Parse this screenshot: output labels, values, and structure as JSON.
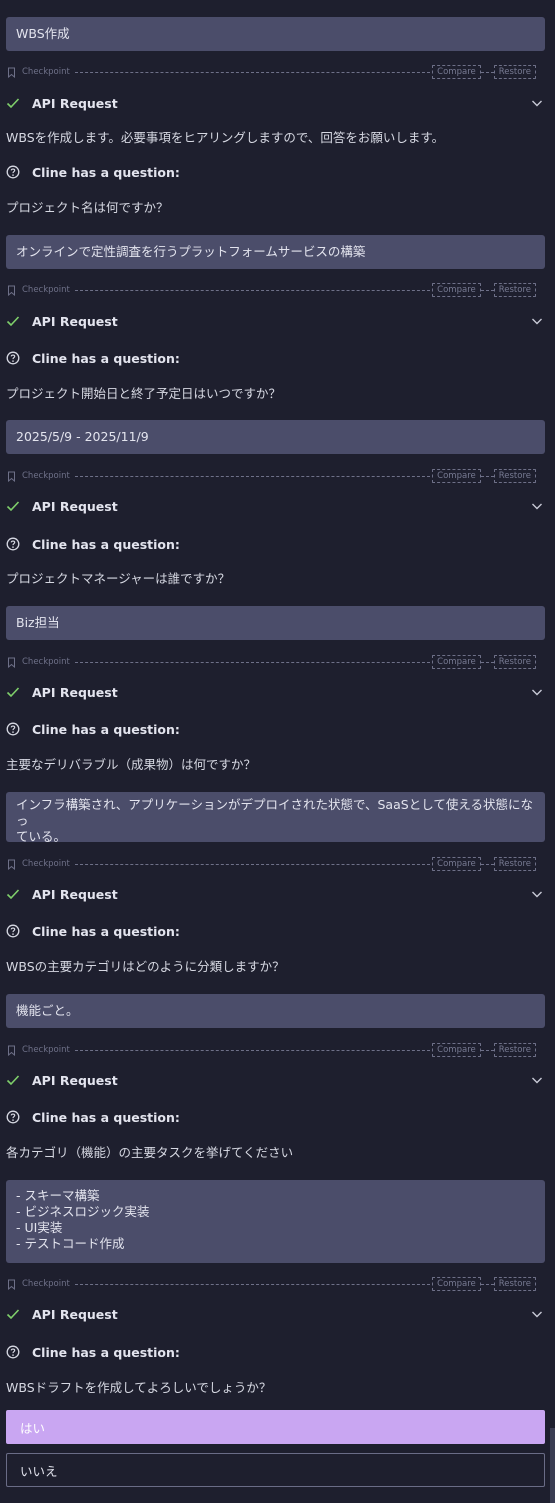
{
  "colors": {
    "background": "#1e1f2e",
    "user_bubble": "#4b4d6a",
    "check_green": "#7fcf6b",
    "primary_button": "#c9a6f2",
    "secondary_border": "#6a6c86"
  },
  "icons": {
    "checkpoint": "bookmark-icon",
    "success": "check-icon",
    "question": "question-circle-icon",
    "expand": "chevron-down-icon"
  },
  "labels": {
    "checkpoint": "Checkpoint",
    "compare": "Compare",
    "restore": "Restore",
    "api_request": "API Request",
    "question": "Cline has a question:"
  },
  "messages": {
    "u0": "WBS作成",
    "t0": "WBSを作成します。必要事項をヒアリングしますので、回答をお願いします。",
    "q1": "プロジェクト名は何ですか？",
    "u1": "オンラインで定性調査を行うプラットフォームサービスの構築",
    "q2": "プロジェクト開始日と終了予定日はいつですか？",
    "u2": "2025/5/9 - 2025/11/9",
    "q3": "プロジェクトマネージャーは誰ですか？",
    "u3": "Biz担当",
    "q4": "主要なデリバラブル（成果物）は何ですか？",
    "u4": "インフラ構築され、アプリケーションがデプロイされた状態で、SaaSとして使える状態になっ\nている。",
    "q5": "WBSの主要カテゴリはどのように分類しますか？",
    "u5": "機能ごと。",
    "q6": "各カテゴリ（機能）の主要タスクを挙げてください",
    "u6": "- スキーマ構築\n- ビジネスロジック実装\n- UI実装\n- テストコード作成",
    "q7": "WBSドラフトを作成してよろしいでしょうか？"
  },
  "options": {
    "yes": "はい",
    "no": "いいえ"
  }
}
